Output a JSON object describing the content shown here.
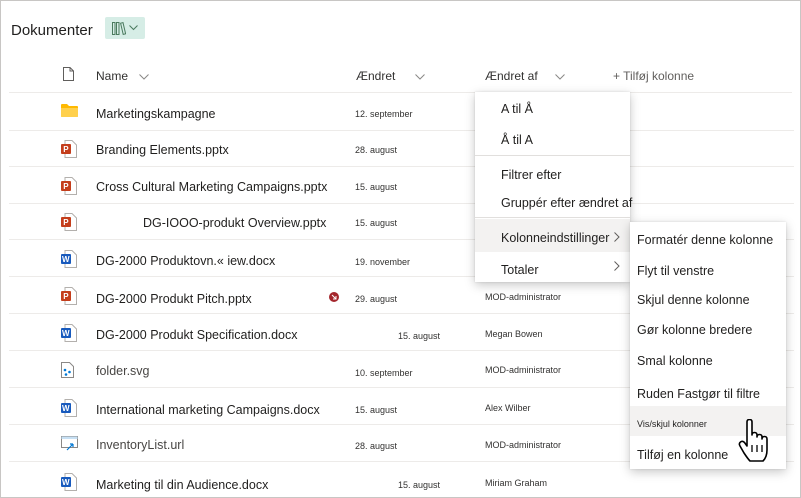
{
  "library": {
    "title": "Dokumenter"
  },
  "columns": {
    "name": "Name",
    "modified": "Ændret",
    "modified_by": "Ændret af",
    "add_column": "+ Tilføj kolonne"
  },
  "files": [
    {
      "icon": "folder-icon",
      "name": "Marketingskampagne",
      "modified": "12. september",
      "modified_by": ""
    },
    {
      "icon": "powerpoint-icon",
      "name": "Branding Elements.pptx",
      "modified": "28. august",
      "modified_by": ""
    },
    {
      "icon": "powerpoint-icon",
      "name": "Cross Cultural Marketing Campaigns.pptx",
      "modified": "15. august",
      "modified_by": ""
    },
    {
      "icon": "powerpoint-icon",
      "name": "DG-IOOO-produkt Overview.pptx",
      "modified": "15. august",
      "modified_by": ""
    },
    {
      "icon": "word-icon",
      "name": "DG-2000 Produktovn.« iew.docx",
      "modified": "19. november",
      "modified_by": ""
    },
    {
      "icon": "powerpoint-icon",
      "name": "DG-2000 Produkt Pitch.pptx",
      "modified": "29. august",
      "modified_by": "MOD-administrator"
    },
    {
      "icon": "word-icon",
      "name": "DG-2000 Produkt Specification.docx",
      "modified": "15. august",
      "modified_by": "Megan Bowen"
    },
    {
      "icon": "svg-file-icon",
      "name": "folder.svg",
      "modified": "10. september",
      "modified_by": "MOD-administrator"
    },
    {
      "icon": "word-icon",
      "name": "International marketing Campaigns.docx",
      "modified": "15. august",
      "modified_by": "Alex Wilber"
    },
    {
      "icon": "url-file-icon",
      "name": "InventoryList.url",
      "modified": "28. august",
      "modified_by": "MOD-administrator"
    },
    {
      "icon": "word-icon",
      "name": "Marketing til din Audience.docx",
      "modified": "15. august",
      "modified_by": "Miriam Graham"
    }
  ],
  "column_menu": {
    "items": [
      "A til Å",
      "Å til A",
      "Filtrer efter",
      "Gruppér efter ændret af",
      "Kolonneindstillinger",
      "Totaler"
    ]
  },
  "submenu": {
    "items": [
      "Formatér denne kolonne",
      "Flyt til venstre",
      "Skjul denne kolonne",
      "Gør kolonne bredere",
      "Smal kolonne",
      "Ruden Fastgør til filtre",
      "Vis/skjul kolonner",
      "Tilføj en kolonne"
    ]
  },
  "colors": {
    "accent": "#0078d4",
    "folder": "#ffb900",
    "powerpoint": "#c43e1c",
    "word": "#185abd",
    "highlight": "#f3f2f1",
    "badge": "#a4262c"
  }
}
